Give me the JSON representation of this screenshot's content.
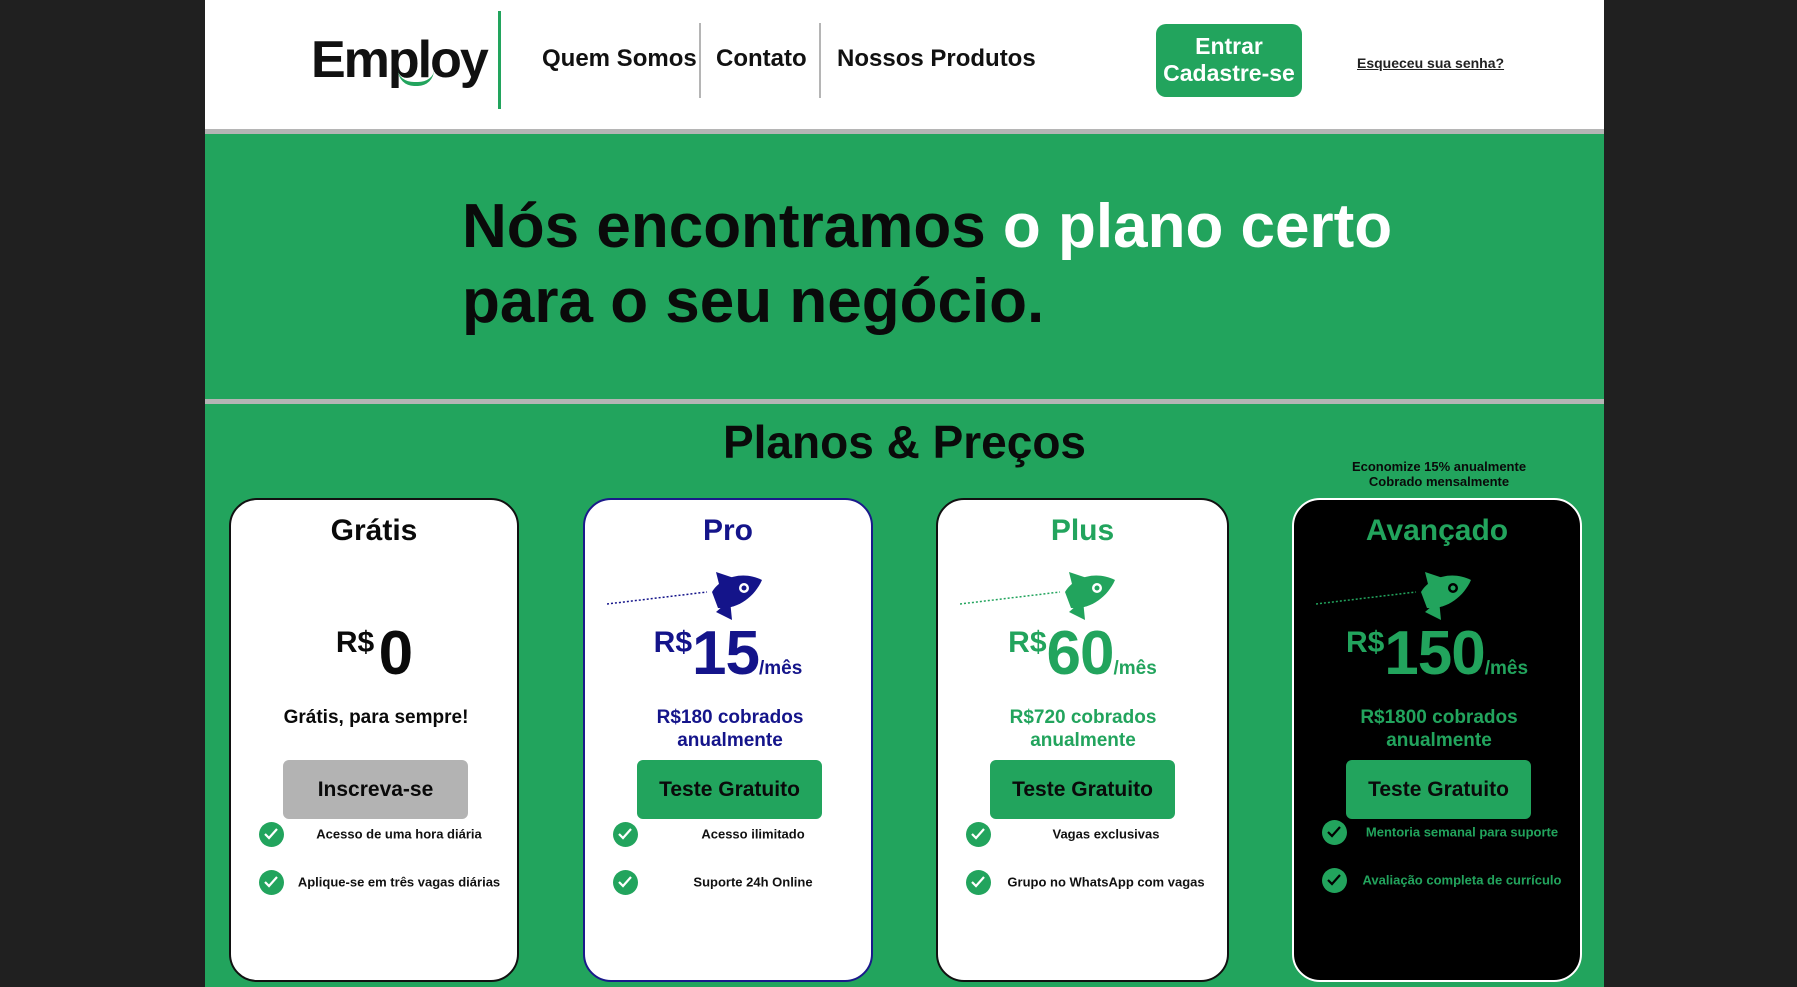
{
  "header": {
    "logo": "Employ",
    "nav": [
      "Quem Somos",
      "Contato",
      "Nossos Produtos"
    ],
    "login_line1": "Entrar",
    "login_line2": "Cadastre-se",
    "forgot": "Esqueceu sua senha?"
  },
  "hero": {
    "title_part1": "Nós encontramos ",
    "title_highlight": "o plano certo",
    "title_part2": "para o seu negócio."
  },
  "plans": {
    "title": "Planos & Preços",
    "save_note_line1": "Economize 15% anualmente",
    "save_note_line2": "Cobrado mensalmente",
    "colors": {
      "green": "#22a45d",
      "navy": "#14148a",
      "black": "#0a0a0a"
    },
    "cards": [
      {
        "name": "Grátis",
        "currency": "R$",
        "amount": "0",
        "period": "",
        "billing": "Grátis, para sempre!",
        "cta": "Inscreva-se",
        "features": [
          "Acesso de uma hora diária",
          "Aplique-se em três vagas diárias"
        ]
      },
      {
        "name": "Pro",
        "currency": "R$",
        "amount": "15",
        "period": "/mês",
        "billing": "R$180 cobrados anualmente",
        "cta": "Teste Gratuito",
        "features": [
          "Acesso ilimitado",
          "Suporte 24h Online"
        ]
      },
      {
        "name": "Plus",
        "currency": "R$",
        "amount": "60",
        "period": "/mês",
        "billing": "R$720 cobrados anualmente",
        "cta": "Teste Gratuito",
        "features": [
          "Vagas exclusivas",
          "Grupo no WhatsApp com vagas"
        ]
      },
      {
        "name": "Avançado",
        "currency": "R$",
        "amount": "150",
        "period": "/mês",
        "billing": "R$1800 cobrados anualmente",
        "cta": "Teste Gratuito",
        "features": [
          "Mentoria semanal para suporte",
          "Avaliação completa de currículo"
        ]
      }
    ]
  }
}
